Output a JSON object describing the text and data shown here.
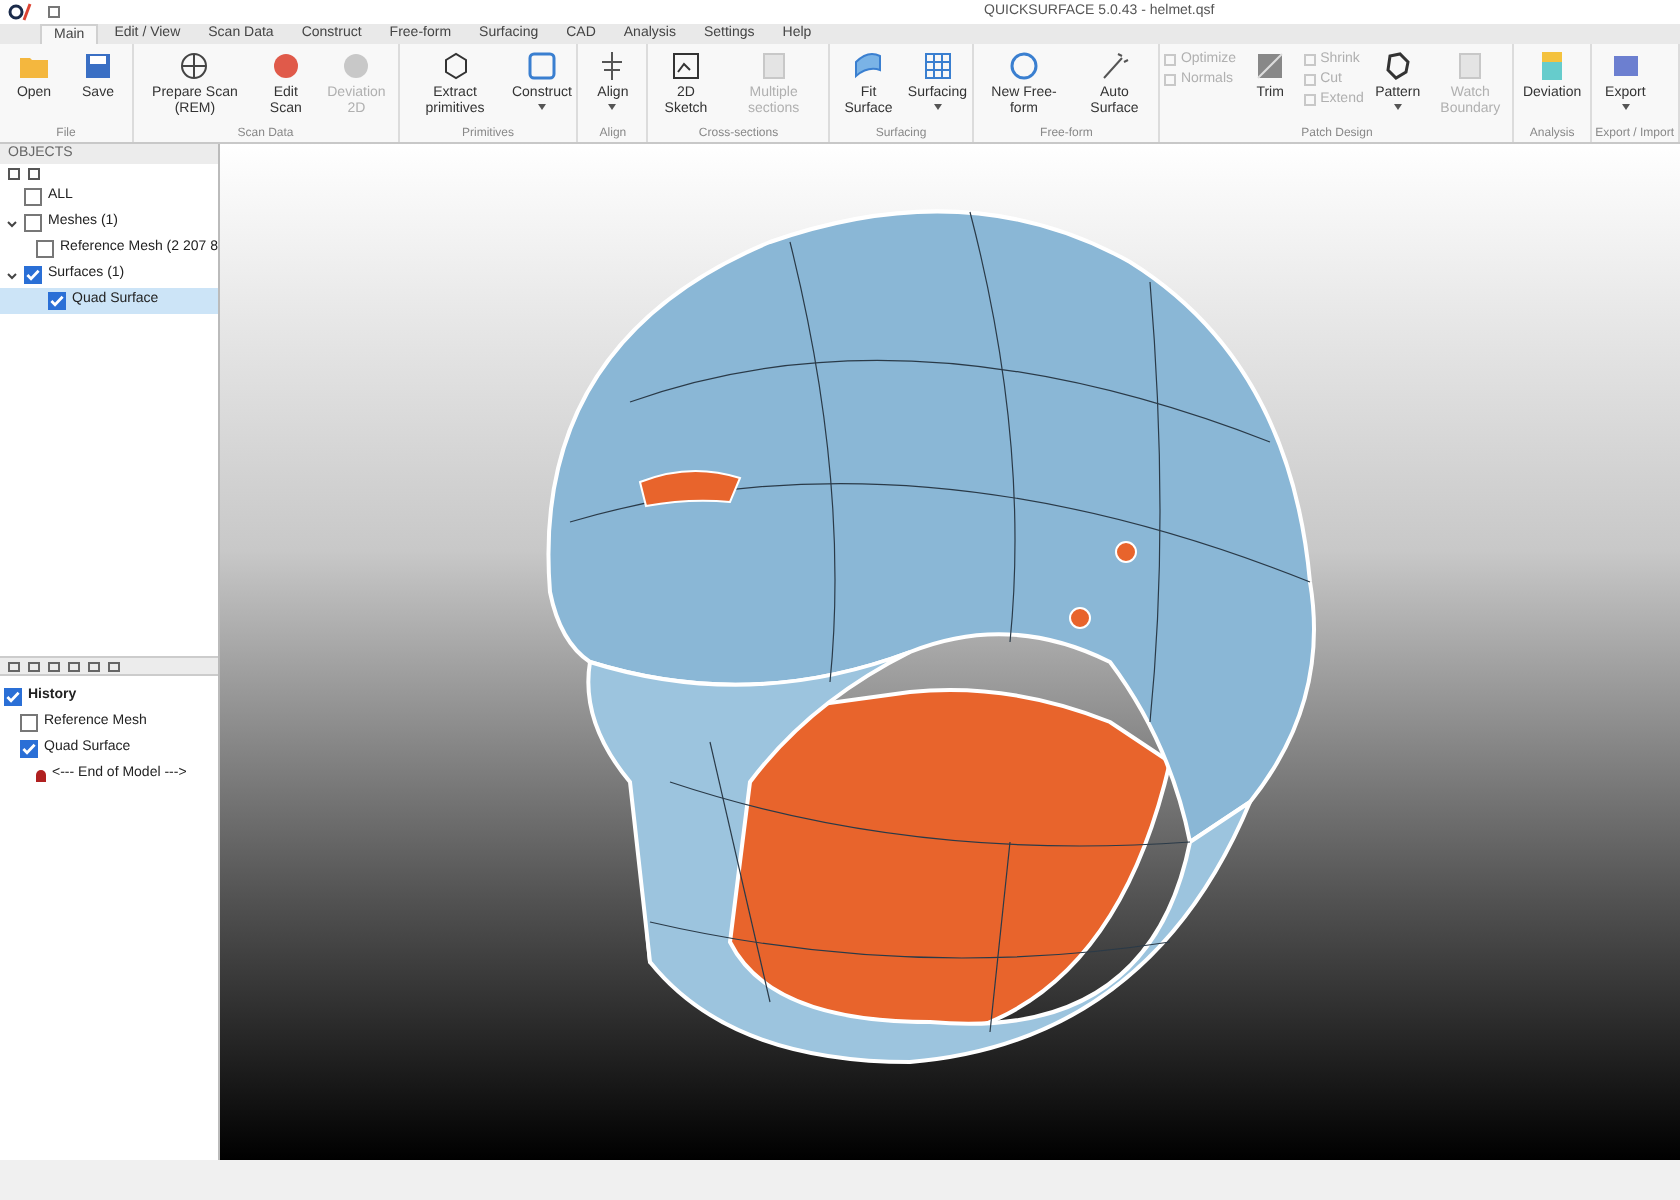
{
  "window": {
    "title": "QUICKSURFACE 5.0.43 - helmet.qsf"
  },
  "tabs": [
    {
      "label": "Main",
      "selected": true
    },
    {
      "label": "Edit / View",
      "selected": false
    },
    {
      "label": "Scan Data",
      "selected": false
    },
    {
      "label": "Construct",
      "selected": false
    },
    {
      "label": "Free-form",
      "selected": false
    },
    {
      "label": "Surfacing",
      "selected": false
    },
    {
      "label": "CAD",
      "selected": false
    },
    {
      "label": "Analysis",
      "selected": false
    },
    {
      "label": "Settings",
      "selected": false
    },
    {
      "label": "Help",
      "selected": false
    }
  ],
  "ribbon_groups": [
    {
      "label": "File",
      "buttons": [
        {
          "label": "Open",
          "disabled": false,
          "dropdown": false
        },
        {
          "label": "Save",
          "disabled": false,
          "dropdown": false
        }
      ]
    },
    {
      "label": "Scan Data",
      "buttons": [
        {
          "label": "Prepare Scan (REM)",
          "disabled": false,
          "dropdown": false
        },
        {
          "label": "Edit Scan",
          "disabled": false,
          "dropdown": false
        },
        {
          "label": "Deviation 2D",
          "disabled": true,
          "dropdown": false
        }
      ]
    },
    {
      "label": "Primitives",
      "buttons": [
        {
          "label": "Extract primitives",
          "disabled": false,
          "dropdown": false
        },
        {
          "label": "Construct",
          "disabled": false,
          "dropdown": true
        }
      ]
    },
    {
      "label": "Align",
      "buttons": [
        {
          "label": "Align",
          "disabled": false,
          "dropdown": true
        }
      ]
    },
    {
      "label": "Cross-sections",
      "buttons": [
        {
          "label": "2D Sketch",
          "disabled": false,
          "dropdown": false
        },
        {
          "label": "Multiple sections",
          "disabled": true,
          "dropdown": false
        }
      ]
    },
    {
      "label": "Surfacing",
      "buttons": [
        {
          "label": "Fit Surface",
          "disabled": false,
          "dropdown": false
        },
        {
          "label": "Surfacing",
          "disabled": false,
          "dropdown": true
        }
      ]
    },
    {
      "label": "Free-form",
      "buttons": [
        {
          "label": "New Free-form",
          "disabled": false,
          "dropdown": false
        },
        {
          "label": "Auto Surface",
          "disabled": false,
          "dropdown": false
        }
      ]
    },
    {
      "label": "Patch Design",
      "small": [
        {
          "label": "Optimize",
          "disabled": true
        },
        {
          "label": "Normals",
          "disabled": true
        }
      ],
      "buttons": [
        {
          "label": "Trim",
          "disabled": false,
          "dropdown": false
        }
      ],
      "small2": [
        {
          "label": "Shrink",
          "disabled": true
        },
        {
          "label": "Cut",
          "disabled": true
        },
        {
          "label": "Extend",
          "disabled": true
        }
      ],
      "buttons2": [
        {
          "label": "Pattern",
          "disabled": false,
          "dropdown": true
        },
        {
          "label": "Watch Boundary",
          "disabled": true,
          "dropdown": false
        }
      ]
    },
    {
      "label": "Analysis",
      "buttons": [
        {
          "label": "Deviation",
          "disabled": false,
          "dropdown": false
        }
      ]
    },
    {
      "label": "Export / Import",
      "buttons": [
        {
          "label": "Export",
          "disabled": false,
          "dropdown": true
        }
      ]
    }
  ],
  "objects_panel": {
    "title": "OBJECTS",
    "tree": [
      {
        "label": "ALL",
        "checked": false,
        "selected": false
      },
      {
        "label": "Meshes (1)",
        "checked": false,
        "expanded": true,
        "selected": false,
        "children": [
          {
            "label": "Reference Mesh (2 207 8",
            "checked": false,
            "selected": false
          }
        ]
      },
      {
        "label": "Surfaces (1)",
        "checked": true,
        "expanded": true,
        "selected": false,
        "children": [
          {
            "label": "Quad Surface",
            "checked": true,
            "selected": true
          }
        ]
      }
    ]
  },
  "history_panel": {
    "items": [
      {
        "label": "History",
        "kind": "header",
        "checked": true
      },
      {
        "label": "Reference Mesh",
        "kind": "item",
        "checked": false
      },
      {
        "label": "Quad Surface",
        "kind": "item",
        "checked": true
      },
      {
        "label": "<--- End of Model --->",
        "kind": "end"
      }
    ]
  }
}
